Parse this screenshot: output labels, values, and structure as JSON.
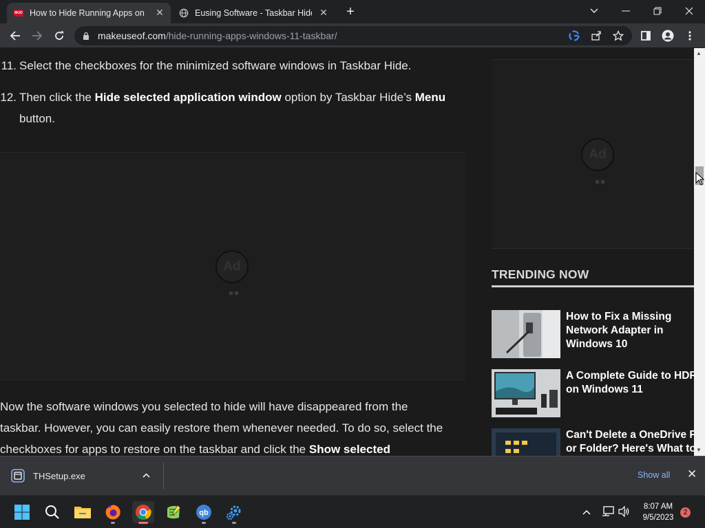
{
  "browser": {
    "tabs": [
      {
        "title": "How to Hide Running Apps on th",
        "active": true
      },
      {
        "title": "Eusing Software - Taskbar Hide -",
        "active": false
      }
    ],
    "address": {
      "host": "makeuseof.com",
      "path": "/hide-running-apps-windows-11-taskbar/"
    }
  },
  "article": {
    "step11": {
      "num": "11.",
      "text": "Select the checkboxes for the minimized software windows in Taskbar Hide."
    },
    "step12": {
      "num": "12.",
      "pre": "Then click the ",
      "bold1": "Hide selected application window",
      "mid": " option by Taskbar Hide’s ",
      "bold2": "Menu",
      "post": "button."
    },
    "ad_label": "Ad",
    "paragraph": {
      "line1": "Now the software windows you selected to hide will have disappeared from the",
      "line2": "taskbar. However, you can easily restore them whenever needed. To do so, select the",
      "line3_pre": "checkboxes for apps to restore on the taskbar and click the ",
      "line3_bold": "Show selected"
    }
  },
  "sidebar": {
    "ad_label": "Ad",
    "trending_title": "TRENDING NOW",
    "items": [
      {
        "line1": "How to Fix a Missing",
        "line2": "Network Adapter in",
        "line3": "Windows 10"
      },
      {
        "line1": "A Complete Guide to HDR",
        "line2": "on Windows 11",
        "line3": ""
      },
      {
        "line1": "Can't Delete a OneDrive Fi",
        "line2": "or Folder? Here's What to",
        "line3": ""
      }
    ]
  },
  "downloads": {
    "file": "THSetup.exe",
    "show_all": "Show all"
  },
  "taskbar": {
    "time": "8:07 AM",
    "date": "9/5/2023",
    "notifications": "2"
  },
  "colors": {
    "page_bg": "#1b1b1b",
    "link_blue": "#8ab4f8",
    "chrome_red": "#ff6b6b"
  }
}
